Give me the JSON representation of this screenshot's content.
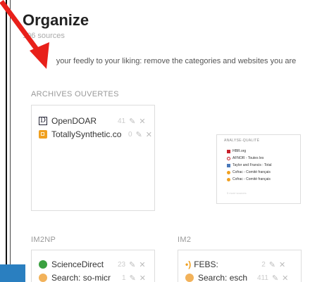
{
  "page": {
    "title": "Organize",
    "subtitle": "106 sources",
    "intro": "Organize your feedly to your liking: remove the categories and websites you are"
  },
  "categories": [
    {
      "title": "ARCHIVES OUVERTES",
      "sources": [
        {
          "name": "OpenDOAR",
          "count": "41",
          "icon": "opendoar-icon"
        },
        {
          "name": "TotallySynthetic.co",
          "count": "0",
          "icon": "totallysynthetic-icon"
        }
      ]
    },
    {
      "title": "ANALYSE-QUALITÉ",
      "sources": [
        {
          "name": "HBR.org",
          "icon": "hbr-icon"
        },
        {
          "name": "AFNOR - Toutes les",
          "icon": "afnor-icon"
        },
        {
          "name": "Taylor and Francis : Total",
          "icon": "taylor-icon"
        },
        {
          "name": "Cofrac - Comité français",
          "icon": "rss-icon"
        },
        {
          "name": "Cofrac - Comité français",
          "icon": "rss-icon"
        }
      ],
      "more": "5 more sources"
    },
    {
      "title": "IM2NP",
      "sources": [
        {
          "name": "ScienceDirect",
          "count": "23",
          "icon": "sciencedirect-icon"
        },
        {
          "name": "Search: so-micr",
          "count": "1",
          "icon": "search-icon"
        }
      ]
    },
    {
      "title": "IM2",
      "sources": [
        {
          "name": "FEBS:",
          "count": "2",
          "icon": "rss-icon"
        },
        {
          "name": "Search: esch",
          "count": "411",
          "icon": "search-icon"
        }
      ]
    }
  ],
  "actions": {
    "edit_glyph": "✎",
    "remove_glyph": "✕"
  },
  "colors": {
    "annotation_arrow": "#e8201a",
    "accent": "#2a7fc0"
  }
}
